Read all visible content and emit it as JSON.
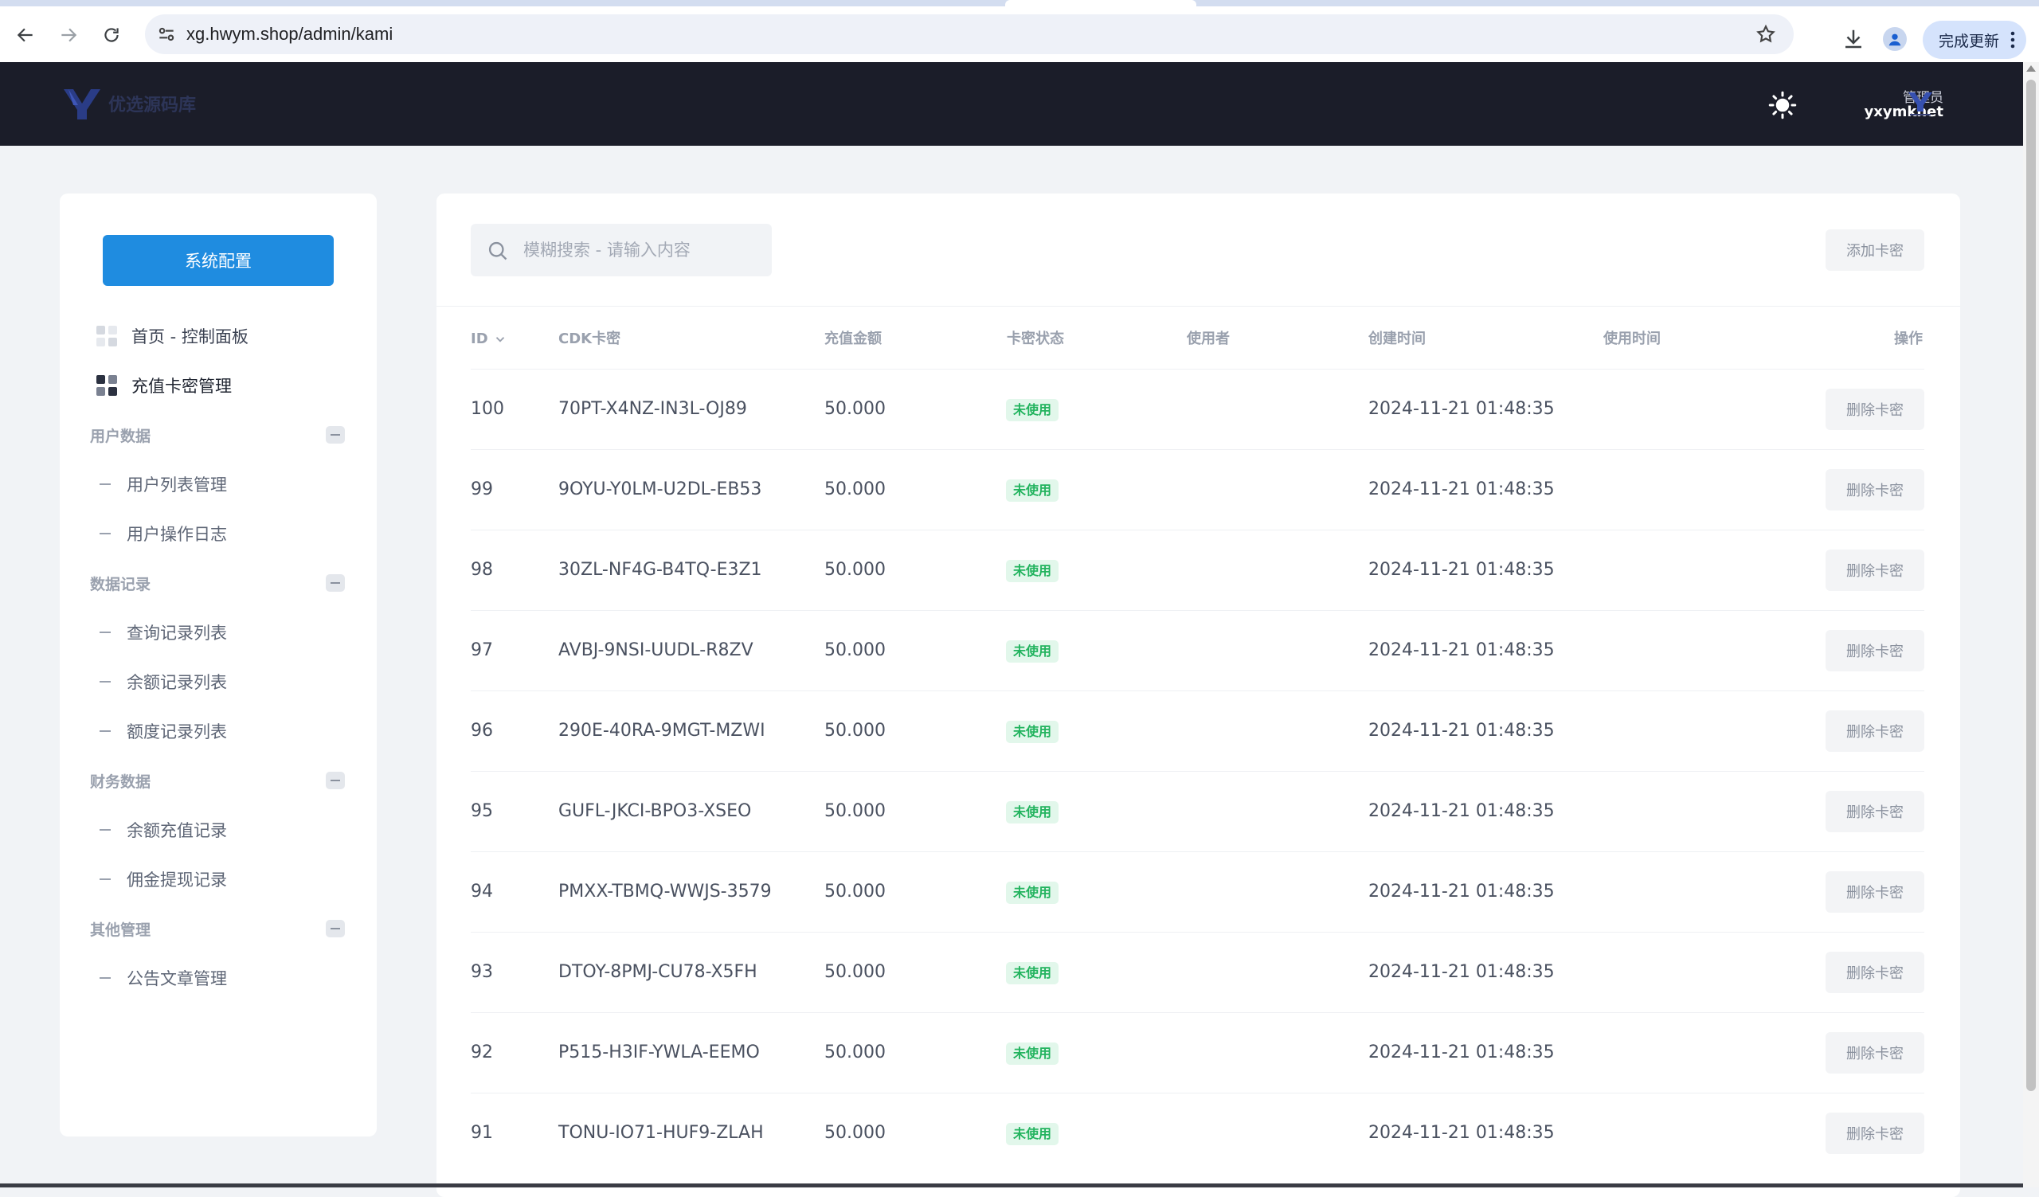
{
  "browser": {
    "url": "xg.hwym.shop/admin/kami",
    "update_button": "完成更新"
  },
  "header": {
    "logo_text": "优选源码库",
    "user_role": "管理员",
    "user_name": "yxymknet"
  },
  "sidebar": {
    "config_button": "系统配置",
    "items": [
      {
        "label": "首页 - 控制面板",
        "icon": "dashboard-grid-icon"
      },
      {
        "label": "充值卡密管理",
        "icon": "dashboard-grid-icon",
        "active": true
      }
    ],
    "groups": [
      {
        "title": "用户数据",
        "items": [
          "用户列表管理",
          "用户操作日志"
        ]
      },
      {
        "title": "数据记录",
        "items": [
          "查询记录列表",
          "余额记录列表",
          "额度记录列表"
        ]
      },
      {
        "title": "财务数据",
        "items": [
          "余额充值记录",
          "佣金提现记录"
        ]
      },
      {
        "title": "其他管理",
        "items": [
          "公告文章管理"
        ]
      }
    ]
  },
  "main": {
    "search_placeholder": "模糊搜索 - 请输入内容",
    "add_button": "添加卡密",
    "columns": {
      "id": "ID",
      "cdk": "CDK卡密",
      "amount": "充值金额",
      "status": "卡密状态",
      "user": "使用者",
      "created": "创建时间",
      "used_time": "使用时间",
      "action": "操作"
    },
    "status_color": "#22b35e",
    "rows": [
      {
        "id": "100",
        "cdk": "70PT-X4NZ-IN3L-OJ89",
        "amount": "50.000",
        "status": "未使用",
        "user": "",
        "created": "2024-11-21 01:48:35",
        "used_time": "",
        "action": "删除卡密"
      },
      {
        "id": "99",
        "cdk": "9OYU-Y0LM-U2DL-EB53",
        "amount": "50.000",
        "status": "未使用",
        "user": "",
        "created": "2024-11-21 01:48:35",
        "used_time": "",
        "action": "删除卡密"
      },
      {
        "id": "98",
        "cdk": "30ZL-NF4G-B4TQ-E3Z1",
        "amount": "50.000",
        "status": "未使用",
        "user": "",
        "created": "2024-11-21 01:48:35",
        "used_time": "",
        "action": "删除卡密"
      },
      {
        "id": "97",
        "cdk": "AVBJ-9NSI-UUDL-R8ZV",
        "amount": "50.000",
        "status": "未使用",
        "user": "",
        "created": "2024-11-21 01:48:35",
        "used_time": "",
        "action": "删除卡密"
      },
      {
        "id": "96",
        "cdk": "290E-40RA-9MGT-MZWI",
        "amount": "50.000",
        "status": "未使用",
        "user": "",
        "created": "2024-11-21 01:48:35",
        "used_time": "",
        "action": "删除卡密"
      },
      {
        "id": "95",
        "cdk": "GUFL-JKCI-BPO3-XSEO",
        "amount": "50.000",
        "status": "未使用",
        "user": "",
        "created": "2024-11-21 01:48:35",
        "used_time": "",
        "action": "删除卡密"
      },
      {
        "id": "94",
        "cdk": "PMXX-TBMQ-WWJS-3579",
        "amount": "50.000",
        "status": "未使用",
        "user": "",
        "created": "2024-11-21 01:48:35",
        "used_time": "",
        "action": "删除卡密"
      },
      {
        "id": "93",
        "cdk": "DTOY-8PMJ-CU78-X5FH",
        "amount": "50.000",
        "status": "未使用",
        "user": "",
        "created": "2024-11-21 01:48:35",
        "used_time": "",
        "action": "删除卡密"
      },
      {
        "id": "92",
        "cdk": "P515-H3IF-YWLA-EEMO",
        "amount": "50.000",
        "status": "未使用",
        "user": "",
        "created": "2024-11-21 01:48:35",
        "used_time": "",
        "action": "删除卡密"
      },
      {
        "id": "91",
        "cdk": "TONU-IO71-HUF9-ZLAH",
        "amount": "50.000",
        "status": "未使用",
        "user": "",
        "created": "2024-11-21 01:48:35",
        "used_time": "",
        "action": "删除卡密"
      }
    ]
  }
}
